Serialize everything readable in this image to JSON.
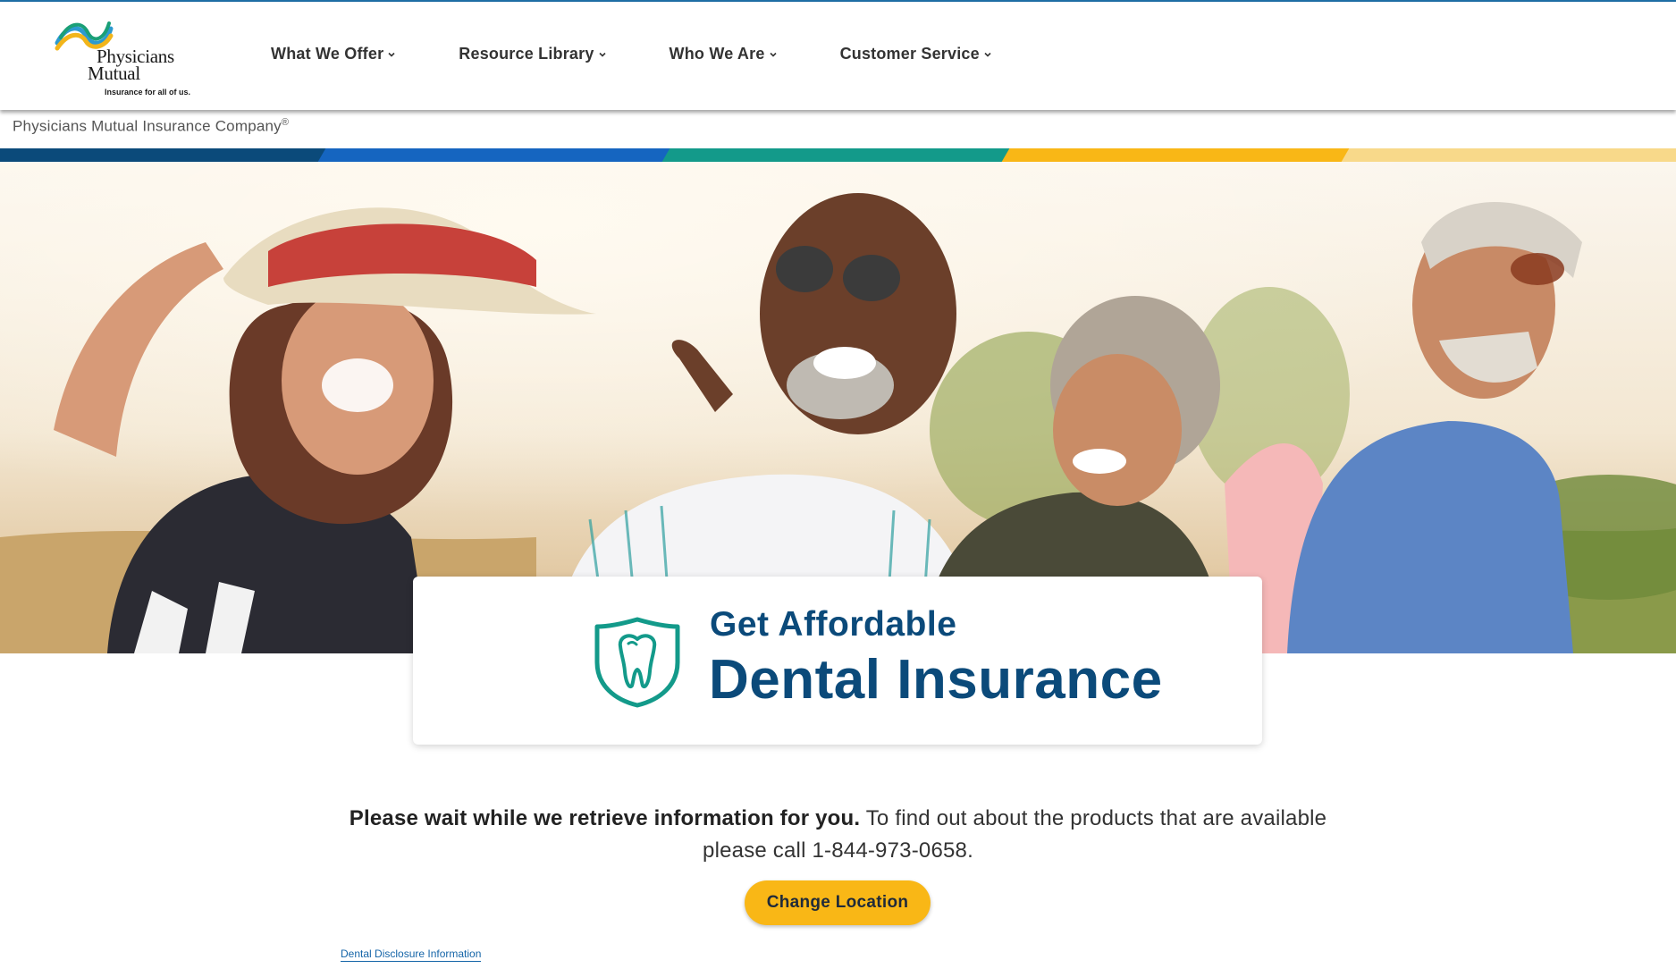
{
  "header": {
    "logo": {
      "brand_line1": "Physicians",
      "brand_line2": "Mutual",
      "tagline": "Insurance for all of us."
    },
    "nav": [
      {
        "label": "What We Offer"
      },
      {
        "label": "Resource Library"
      },
      {
        "label": "Who We Are"
      },
      {
        "label": "Customer Service"
      }
    ]
  },
  "company": {
    "name": "Physicians Mutual Insurance Company",
    "mark": "®"
  },
  "brand_colors": {
    "navy": "#0b4a7a",
    "blue": "#1565c0",
    "teal": "#139a8a",
    "gold": "#f9b716",
    "light_gold": "#f8d98a"
  },
  "hero_card": {
    "icon": "tooth-shield-icon",
    "line1": "Get Affordable",
    "line2": "Dental Insurance"
  },
  "notice": {
    "bold": "Please wait while we retrieve information for you.",
    "text": " To find out about the products that are available please call 1-844-973-0658."
  },
  "actions": {
    "change_location": "Change Location"
  },
  "footer": {
    "disclosure_link": "Dental Disclosure Information"
  }
}
